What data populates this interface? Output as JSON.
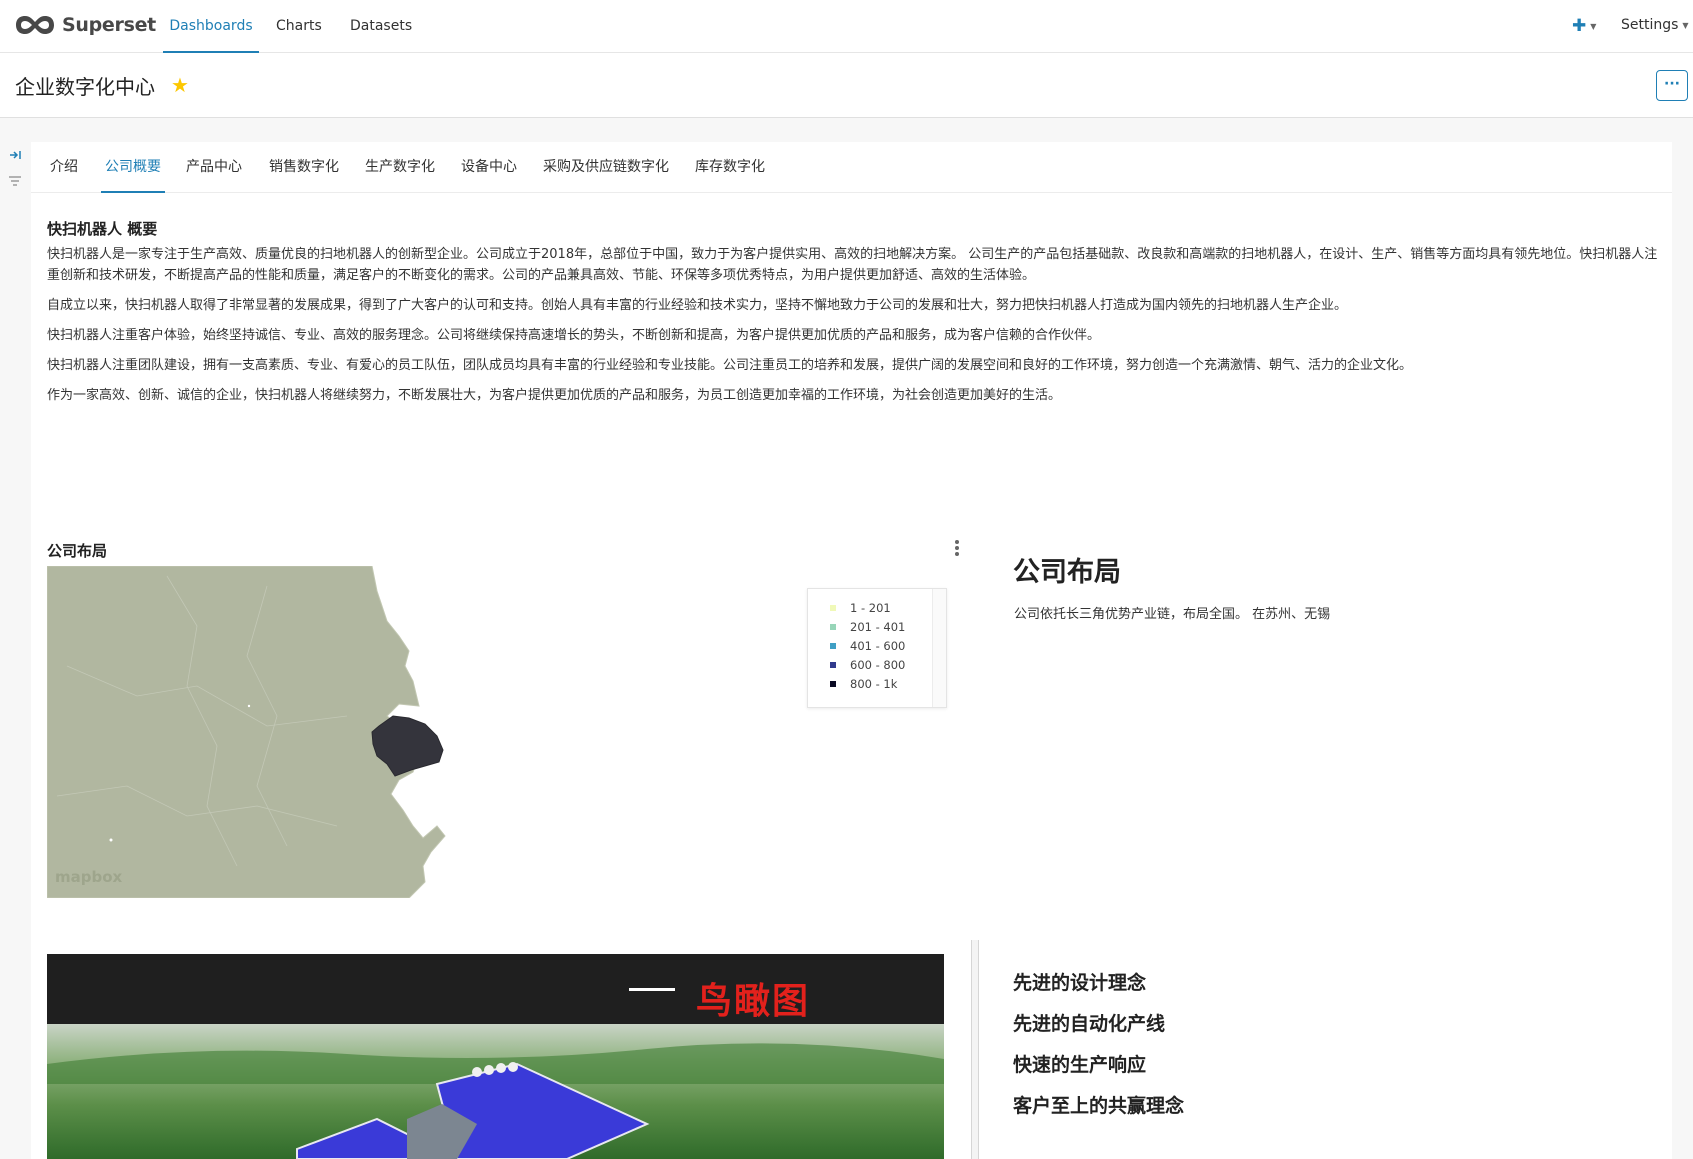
{
  "app": {
    "name": "Superset"
  },
  "nav": {
    "items": [
      {
        "label": "Dashboards",
        "active": true
      },
      {
        "label": "Charts",
        "active": false
      },
      {
        "label": "Datasets",
        "active": false
      }
    ],
    "plus_icon": "plus-icon",
    "settings_label": "Settings"
  },
  "dashboard": {
    "title": "企业数字化中心",
    "favorite": true,
    "more_label": "···"
  },
  "tabs": [
    {
      "label": "介绍",
      "active": false
    },
    {
      "label": "公司概要",
      "active": true
    },
    {
      "label": "产品中心",
      "active": false
    },
    {
      "label": "销售数字化",
      "active": false
    },
    {
      "label": "生产数字化",
      "active": false
    },
    {
      "label": "设备中心",
      "active": false
    },
    {
      "label": "采购及供应链数字化",
      "active": false
    },
    {
      "label": "库存数字化",
      "active": false
    }
  ],
  "intro": {
    "title": "快扫机器人 概要",
    "paragraphs": [
      "快扫机器人是一家专注于生产高效、质量优良的扫地机器人的创新型企业。公司成立于2018年，总部位于中国，致力于为客户提供实用、高效的扫地解决方案。 公司生产的产品包括基础款、改良款和高端款的扫地机器人，在设计、生产、销售等方面均具有领先地位。快扫机器人注重创新和技术研发，不断提高产品的性能和质量，满足客户的不断变化的需求。公司的产品兼具高效、节能、环保等多项优秀特点，为用户提供更加舒适、高效的生活体验。",
      "自成立以来，快扫机器人取得了非常显著的发展成果，得到了广大客户的认可和支持。创始人具有丰富的行业经验和技术实力，坚持不懈地致力于公司的发展和壮大，努力把快扫机器人打造成为国内领先的扫地机器人生产企业。",
      "快扫机器人注重客户体验，始终坚持诚信、专业、高效的服务理念。公司将继续保持高速增长的势头，不断创新和提高，为客户提供更加优质的产品和服务，成为客户信赖的合作伙伴。",
      "快扫机器人注重团队建设，拥有一支高素质、专业、有爱心的员工队伍，团队成员均具有丰富的行业经验和专业技能。公司注重员工的培养和发展，提供广阔的发展空间和良好的工作环境，努力创造一个充满激情、朝气、活力的企业文化。",
      "作为一家高效、创新、诚信的企业，快扫机器人将继续努力，不断发展壮大，为客户提供更加优质的产品和服务，为员工创造更加幸福的工作环境，为社会创造更加美好的生活。"
    ]
  },
  "map_chart": {
    "title": "公司布局",
    "legend": [
      {
        "label": "1 - 201",
        "color": "#f0f9b8"
      },
      {
        "label": "201 - 401",
        "color": "#97d5b8"
      },
      {
        "label": "401 - 600",
        "color": "#3f9fc4"
      },
      {
        "label": "600 - 800",
        "color": "#303a8c"
      },
      {
        "label": "800 - 1k",
        "color": "#0a0a23"
      }
    ],
    "base_color": "#b1b7a0",
    "highlight_color": "#34343c",
    "watermark": "mapbox"
  },
  "layout_card": {
    "heading": "公司布局",
    "text": "公司依托长三角优势产业链，布局全国。 在苏州、无锡"
  },
  "image_card": {
    "caption": "鸟瞰图"
  },
  "features": [
    "先进的设计理念",
    "先进的自动化产线",
    "快速的生产响应",
    "客户至上的共赢理念"
  ]
}
